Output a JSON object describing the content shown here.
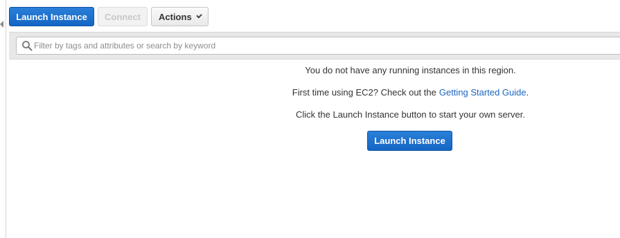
{
  "toolbar": {
    "launch_label": "Launch Instance",
    "connect_label": "Connect",
    "actions_label": "Actions"
  },
  "search": {
    "value": "",
    "placeholder": "Filter by tags and attributes or search by keyword"
  },
  "empty_state": {
    "line_1": "You do not have any running instances in this region.",
    "line_2_prefix": "First time using EC2? Check out the",
    "guide_link": "Getting Started Guide",
    "line_2_suffix": ".",
    "line_3": "Click the Launch Instance button to start your own server.",
    "launch_label": "Launch Instance"
  },
  "icons": {
    "search": "search-icon",
    "actions_dropdown": "chevron-down-icon",
    "collapse_sidebar": "collapse-sidebar-icon"
  },
  "colors": {
    "primary_button": "#1466c4",
    "link": "#1a66c2",
    "disabled_text": "#c8c8c8"
  }
}
